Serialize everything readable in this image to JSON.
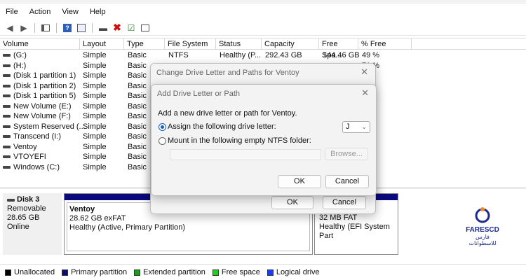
{
  "menu": [
    "File",
    "Action",
    "View",
    "Help"
  ],
  "columns": [
    "Volume",
    "Layout",
    "Type",
    "File System",
    "Status",
    "Capacity",
    "Free Spa...",
    "% Free"
  ],
  "rows": [
    {
      "volume": "(G:)",
      "layout": "Simple",
      "type": "Basic",
      "fs": "NTFS",
      "status": "Healthy (P...",
      "capacity": "292.43 GB",
      "free": "144.46 GB",
      "pct": "49 %"
    },
    {
      "volume": "(H:)",
      "layout": "Simple",
      "type": "Basic",
      "fs": "",
      "status": "",
      "capacity": "",
      "free": "",
      "pct": "71 %"
    },
    {
      "volume": "(Disk 1 partition 1)",
      "layout": "Simple",
      "type": "Basic",
      "fs": "",
      "status": "",
      "capacity": "",
      "free": "",
      "pct": "%"
    },
    {
      "volume": "(Disk 1 partition 2)",
      "layout": "Simple",
      "type": "Basic",
      "fs": "",
      "status": "",
      "capacity": "",
      "free": "",
      "pct": "%"
    },
    {
      "volume": "(Disk 1 partition 5)",
      "layout": "Simple",
      "type": "Basic",
      "fs": "",
      "status": "",
      "capacity": "",
      "free": "",
      "pct": "%"
    },
    {
      "volume": "New Volume (E:)",
      "layout": "Simple",
      "type": "Basic",
      "fs": "",
      "status": "",
      "capacity": "",
      "free": "",
      "pct": "%"
    },
    {
      "volume": "New Volume (F:)",
      "layout": "Simple",
      "type": "Basic",
      "fs": "",
      "status": "",
      "capacity": "",
      "free": "",
      "pct": "%"
    },
    {
      "volume": "System Reserved (...",
      "layout": "Simple",
      "type": "Basic",
      "fs": "",
      "status": "",
      "capacity": "",
      "free": "",
      "pct": "%"
    },
    {
      "volume": "Transcend (I:)",
      "layout": "Simple",
      "type": "Basic",
      "fs": "",
      "status": "",
      "capacity": "",
      "free": "",
      "pct": "%"
    },
    {
      "volume": "Ventoy",
      "layout": "Simple",
      "type": "Basic",
      "fs": "",
      "status": "",
      "capacity": "",
      "free": "",
      "pct": "%"
    },
    {
      "volume": "VTOYEFI",
      "layout": "Simple",
      "type": "Basic",
      "fs": "",
      "status": "",
      "capacity": "",
      "free": "",
      "pct": "%"
    },
    {
      "volume": "Windows (C:)",
      "layout": "Simple",
      "type": "Basic",
      "fs": "",
      "status": "",
      "capacity": "",
      "free": "",
      "pct": "%"
    }
  ],
  "disk": {
    "name": "Disk 3",
    "kind": "Removable",
    "size": "28.65 GB",
    "state": "Online"
  },
  "part1": {
    "name": "Ventoy",
    "size": "28.62 GB exFAT",
    "status": "Healthy (Active, Primary Partition)"
  },
  "part2": {
    "size": "32 MB FAT",
    "status": "Healthy (EFI System Part"
  },
  "legend": [
    {
      "label": "Unallocated",
      "color": "#000000"
    },
    {
      "label": "Primary partition",
      "color": "#0a0a7e"
    },
    {
      "label": "Extended partition",
      "color": "#1f9a1f"
    },
    {
      "label": "Free space",
      "color": "#22cc22"
    },
    {
      "label": "Logical drive",
      "color": "#1a3cff"
    }
  ],
  "dlg1": {
    "title": "Change Drive Letter and Paths for Ventoy",
    "ok": "OK",
    "cancel": "Cancel"
  },
  "dlg2": {
    "title": "Add Drive Letter or Path",
    "prompt": "Add a new drive letter or path for Ventoy.",
    "opt1": "Assign the following drive letter:",
    "opt2": "Mount in the following empty NTFS folder:",
    "letter": "J",
    "browse": "Browse...",
    "ok": "OK",
    "cancel": "Cancel"
  },
  "watermark": {
    "brand": "FARESCD",
    "sub": "فارس للاسطوانات"
  }
}
